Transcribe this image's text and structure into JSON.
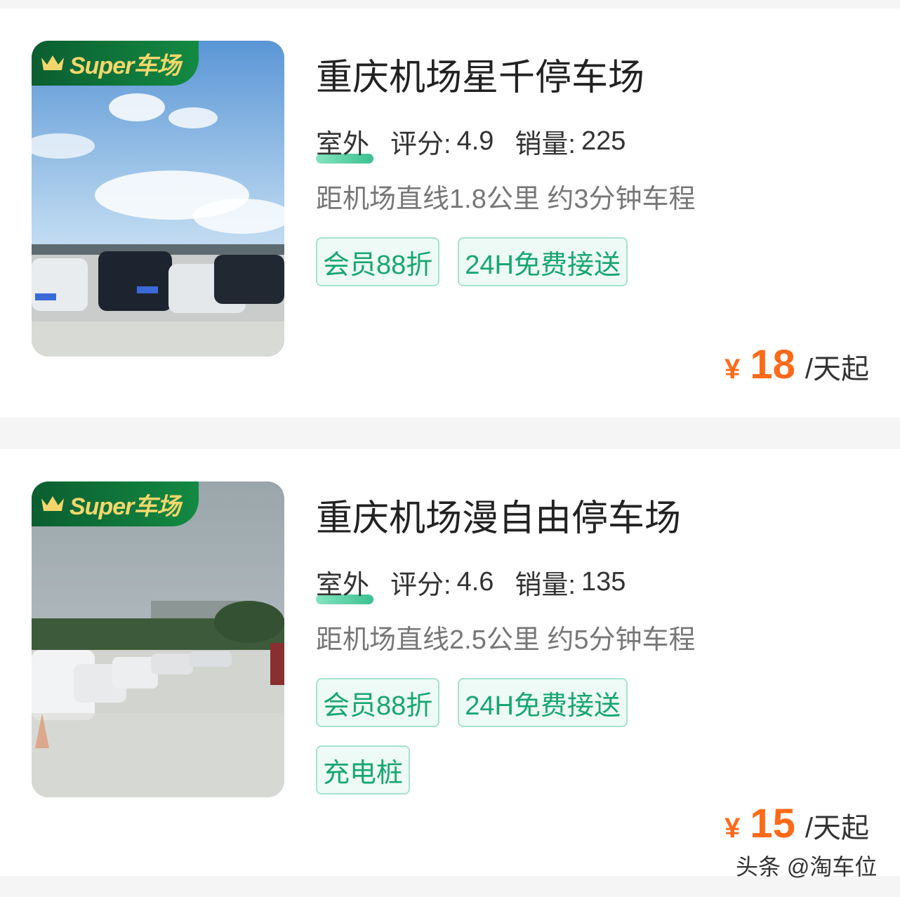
{
  "listings": [
    {
      "badge": "Super车场",
      "title": "重庆机场星千停车场",
      "type": "室外",
      "rating_label": "评分:",
      "rating": "4.9",
      "sales_label": "销量:",
      "sales": "225",
      "distance": "距机场直线1.8公里 约3分钟车程",
      "tags": [
        "会员88折",
        "24H免费接送"
      ],
      "currency": "¥",
      "price": "18",
      "unit": "/天起"
    },
    {
      "badge": "Super车场",
      "title": "重庆机场漫自由停车场",
      "type": "室外",
      "rating_label": "评分:",
      "rating": "4.6",
      "sales_label": "销量:",
      "sales": "135",
      "distance": "距机场直线2.5公里 约5分钟车程",
      "tags": [
        "会员88折",
        "24H免费接送",
        "充电桩"
      ],
      "currency": "¥",
      "price": "15",
      "unit": "/天起"
    }
  ],
  "watermark": "头条 @淘车位",
  "colors": {
    "price": "#ff6a1a",
    "tag_text": "#17a673",
    "tag_border": "#a6e3cd",
    "badge_bg": "#0b5e30",
    "badge_text": "#f3d76c"
  }
}
